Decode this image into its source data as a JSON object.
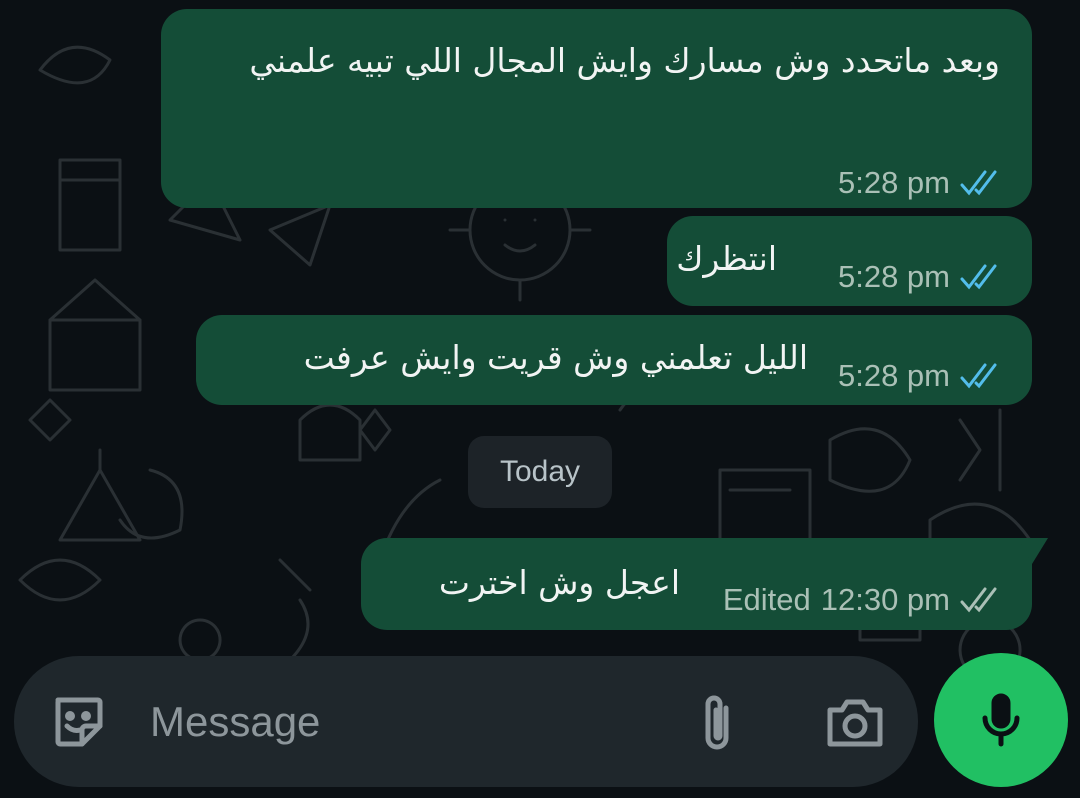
{
  "messages": [
    {
      "text": "وبعد ماتحدد وش مسارك وايش المجال اللي تبيه علمني",
      "time": "5:28 pm",
      "status": "read"
    },
    {
      "text": "انتظرك",
      "time": "5:28 pm",
      "status": "read"
    },
    {
      "text": "الليل تعلمني وش قريت وايش عرفت",
      "time": "5:28 pm",
      "status": "read"
    },
    {
      "text": "اعجل وش اخترت",
      "edited_label": "Edited",
      "time": "12:30 pm",
      "status": "delivered"
    }
  ],
  "date_separator": "Today",
  "composer": {
    "placeholder": "Message",
    "emoji_icon": "sticker-icon",
    "attach_icon": "paperclip-icon",
    "camera_icon": "camera-icon",
    "mic_icon": "microphone-icon"
  },
  "colors": {
    "background": "#0b1014",
    "outgoing_bubble": "#144d37",
    "read_ticks": "#53bdeb",
    "delivered_ticks": "#aac0b6",
    "mic_button": "#21c063",
    "composer": "#1f272c"
  }
}
